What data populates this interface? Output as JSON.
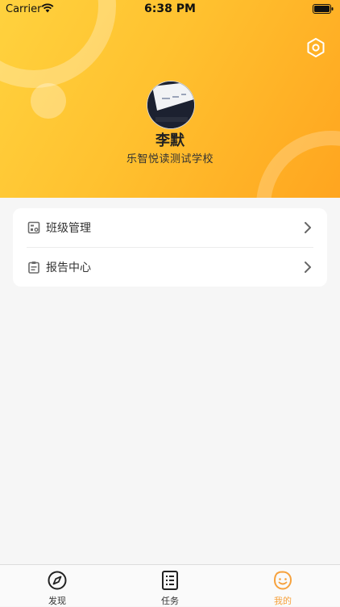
{
  "status_bar": {
    "carrier": "Carrier",
    "time": "6:38 PM"
  },
  "header": {
    "user_name": "李默",
    "school_name": "乐智悦读测试学校",
    "settings_icon": "gear-hexagon-icon",
    "avatar": "user-avatar"
  },
  "menu": {
    "items": [
      {
        "label": "班级管理",
        "icon": "class-management-icon"
      },
      {
        "label": "报告中心",
        "icon": "clipboard-icon"
      }
    ]
  },
  "tabbar": {
    "items": [
      {
        "label": "发现",
        "icon": "compass-icon",
        "active": false
      },
      {
        "label": "任务",
        "icon": "task-list-icon",
        "active": false
      },
      {
        "label": "我的",
        "icon": "smiley-face-icon",
        "active": true
      }
    ]
  },
  "colors": {
    "header_gradient_start": "#ffd23e",
    "header_gradient_end": "#ffa51f",
    "accent": "#f6a13c",
    "background": "#f6f6f6"
  }
}
